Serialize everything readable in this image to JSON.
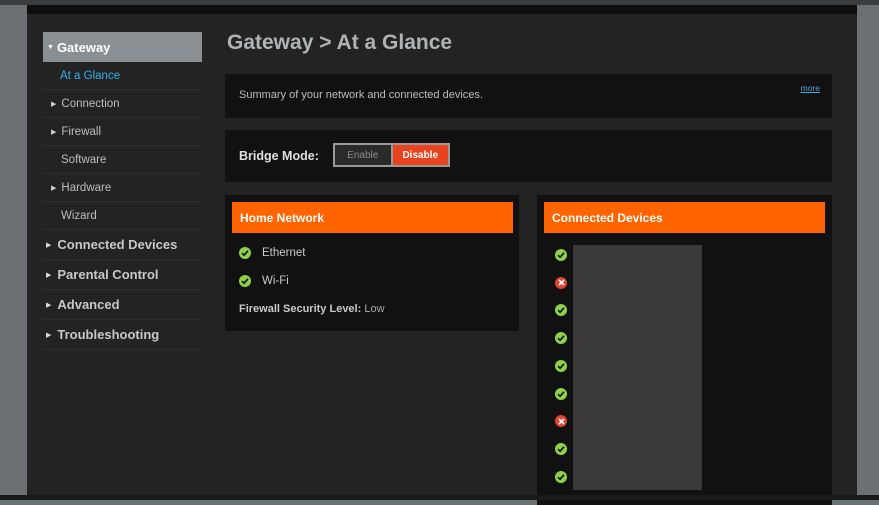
{
  "sidebar": {
    "top": {
      "label": "Gateway"
    },
    "sub": [
      {
        "label": "At a Glance",
        "active": true,
        "expandable": false
      },
      {
        "label": "Connection",
        "active": false,
        "expandable": true
      },
      {
        "label": "Firewall",
        "active": false,
        "expandable": true
      },
      {
        "label": "Software",
        "active": false,
        "expandable": false
      },
      {
        "label": "Hardware",
        "active": false,
        "expandable": true
      },
      {
        "label": "Wizard",
        "active": false,
        "expandable": false
      }
    ],
    "main": [
      {
        "label": "Connected Devices"
      },
      {
        "label": "Parental Control"
      },
      {
        "label": "Advanced"
      },
      {
        "label": "Troubleshooting"
      }
    ]
  },
  "page": {
    "title": "Gateway > At a Glance"
  },
  "summary": {
    "text": "Summary of your network and connected devices.",
    "more": "more"
  },
  "bridge_mode": {
    "label": "Bridge Mode:",
    "enable": "Enable",
    "disable": "Disable",
    "selected": "Disable"
  },
  "home_network": {
    "title": "Home Network",
    "items": [
      {
        "label": "Ethernet",
        "status": "ok"
      },
      {
        "label": "Wi-Fi",
        "status": "ok"
      }
    ],
    "firewall_label": "Firewall Security Level:",
    "firewall_value": "Low"
  },
  "connected_devices": {
    "title": "Connected Devices",
    "statuses": [
      "ok",
      "err",
      "ok",
      "ok",
      "ok",
      "ok",
      "err",
      "ok",
      "ok"
    ]
  },
  "colors": {
    "accent": "#ff6400",
    "active_link": "#35b0ec",
    "disable_button": "#e8421f",
    "ok": "#8ed04a",
    "error": "#e0452d"
  }
}
